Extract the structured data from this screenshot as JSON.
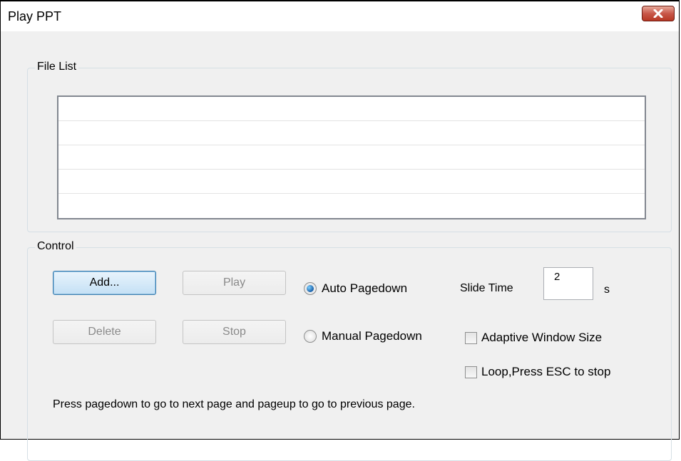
{
  "window": {
    "title": "Play PPT"
  },
  "file_list": {
    "label": "File List",
    "rows": [
      "",
      "",
      "",
      "",
      ""
    ]
  },
  "control": {
    "label": "Control",
    "add_label": "Add...",
    "play_label": "Play",
    "delete_label": "Delete",
    "stop_label": "Stop",
    "auto_pagedown_label": "Auto Pagedown",
    "manual_pagedown_label": "Manual Pagedown",
    "slide_time_label": "Slide Time",
    "slide_time_value": "2",
    "slide_time_unit": "s",
    "adaptive_label": "Adaptive Window Size",
    "loop_label": "Loop,Press ESC to stop",
    "hint": "Press pagedown to go to next page and pageup to go to previous page."
  },
  "icons": {
    "close": "close-icon"
  }
}
